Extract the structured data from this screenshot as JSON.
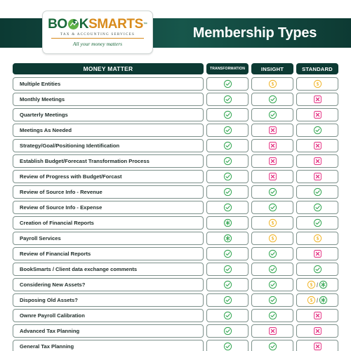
{
  "banner": {
    "title": "Membership Types",
    "bg_color": "#10443c"
  },
  "logo": {
    "word_part1": "BO",
    "word_part2": "K",
    "word_part3": "SMARTS",
    "trademark": "™",
    "subtitle": "TAX & ACCOUNTING SERVICES",
    "tagline": "All your money matters",
    "green": "#18683a",
    "gold": "#d88b1c"
  },
  "table": {
    "headers": {
      "label": "MONEY MATTER",
      "columns": [
        "TRANSFORMATION",
        "INSIGHT",
        "STANDARD"
      ]
    },
    "legend_colors": {
      "check": "#2aa24a",
      "cross": "#e3257b",
      "dollar": "#f0b323",
      "asterisk": "#2aa24a"
    },
    "rows": [
      {
        "label": "Multiple Entities",
        "marks": [
          "check",
          "dollar",
          "dollar"
        ]
      },
      {
        "label": "Monthly Meetings",
        "marks": [
          "check",
          "check",
          "cross"
        ]
      },
      {
        "label": "Quarterly Meetings",
        "marks": [
          "check",
          "check",
          "cross"
        ]
      },
      {
        "label": "Meetings As Needed",
        "marks": [
          "check",
          "cross",
          "check"
        ]
      },
      {
        "label": "Strategy/Goal/Positioning Identification",
        "marks": [
          "check",
          "cross",
          "cross"
        ]
      },
      {
        "label": "Establish Budget/Forecast Transformation Process",
        "marks": [
          "check",
          "cross",
          "cross"
        ]
      },
      {
        "label": "Review of Progress with Budget/Forcast",
        "marks": [
          "check",
          "cross",
          "cross"
        ]
      },
      {
        "label": "Review of Source Info - Revenue",
        "marks": [
          "check",
          "check",
          "check"
        ]
      },
      {
        "label": "Review of Source Info - Expense",
        "marks": [
          "check",
          "check",
          "check"
        ]
      },
      {
        "label": "Creation of Financial Reports",
        "marks": [
          "asterisk",
          "dollar",
          "check"
        ]
      },
      {
        "label": "Payroll Services",
        "marks": [
          "asterisk",
          "dollar",
          "dollar"
        ]
      },
      {
        "label": "Review of Financial Reports",
        "marks": [
          "check",
          "check",
          "cross"
        ]
      },
      {
        "label": "BookSmarts / Client data exchange comments",
        "marks": [
          "check",
          "check",
          "check"
        ]
      },
      {
        "label": "Considering New Assets?",
        "marks": [
          "check",
          "check",
          "dollar/asterisk"
        ]
      },
      {
        "label": "Disposing Old Assets?",
        "marks": [
          "check",
          "check",
          "dollar/asterisk"
        ]
      },
      {
        "label": "Ownre Payroll Calibration",
        "marks": [
          "check",
          "check",
          "cross"
        ]
      },
      {
        "label": "Advanced Tax Planning",
        "marks": [
          "check",
          "cross",
          "cross"
        ]
      },
      {
        "label": "General Tax Planning",
        "marks": [
          "check",
          "check",
          "cross"
        ]
      }
    ]
  }
}
